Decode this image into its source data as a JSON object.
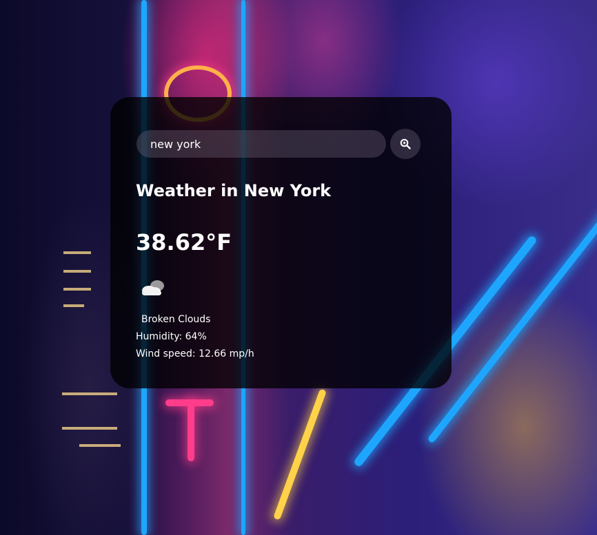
{
  "search": {
    "value": "new york",
    "icon": "magnifier-icon"
  },
  "weather": {
    "title": "Weather in New York",
    "temperature": "38.62°F",
    "condition_icon": "broken-clouds-icon",
    "description": "Broken Clouds",
    "humidity": "Humidity: 64%",
    "wind": "Wind speed: 12.66 mp/h"
  }
}
